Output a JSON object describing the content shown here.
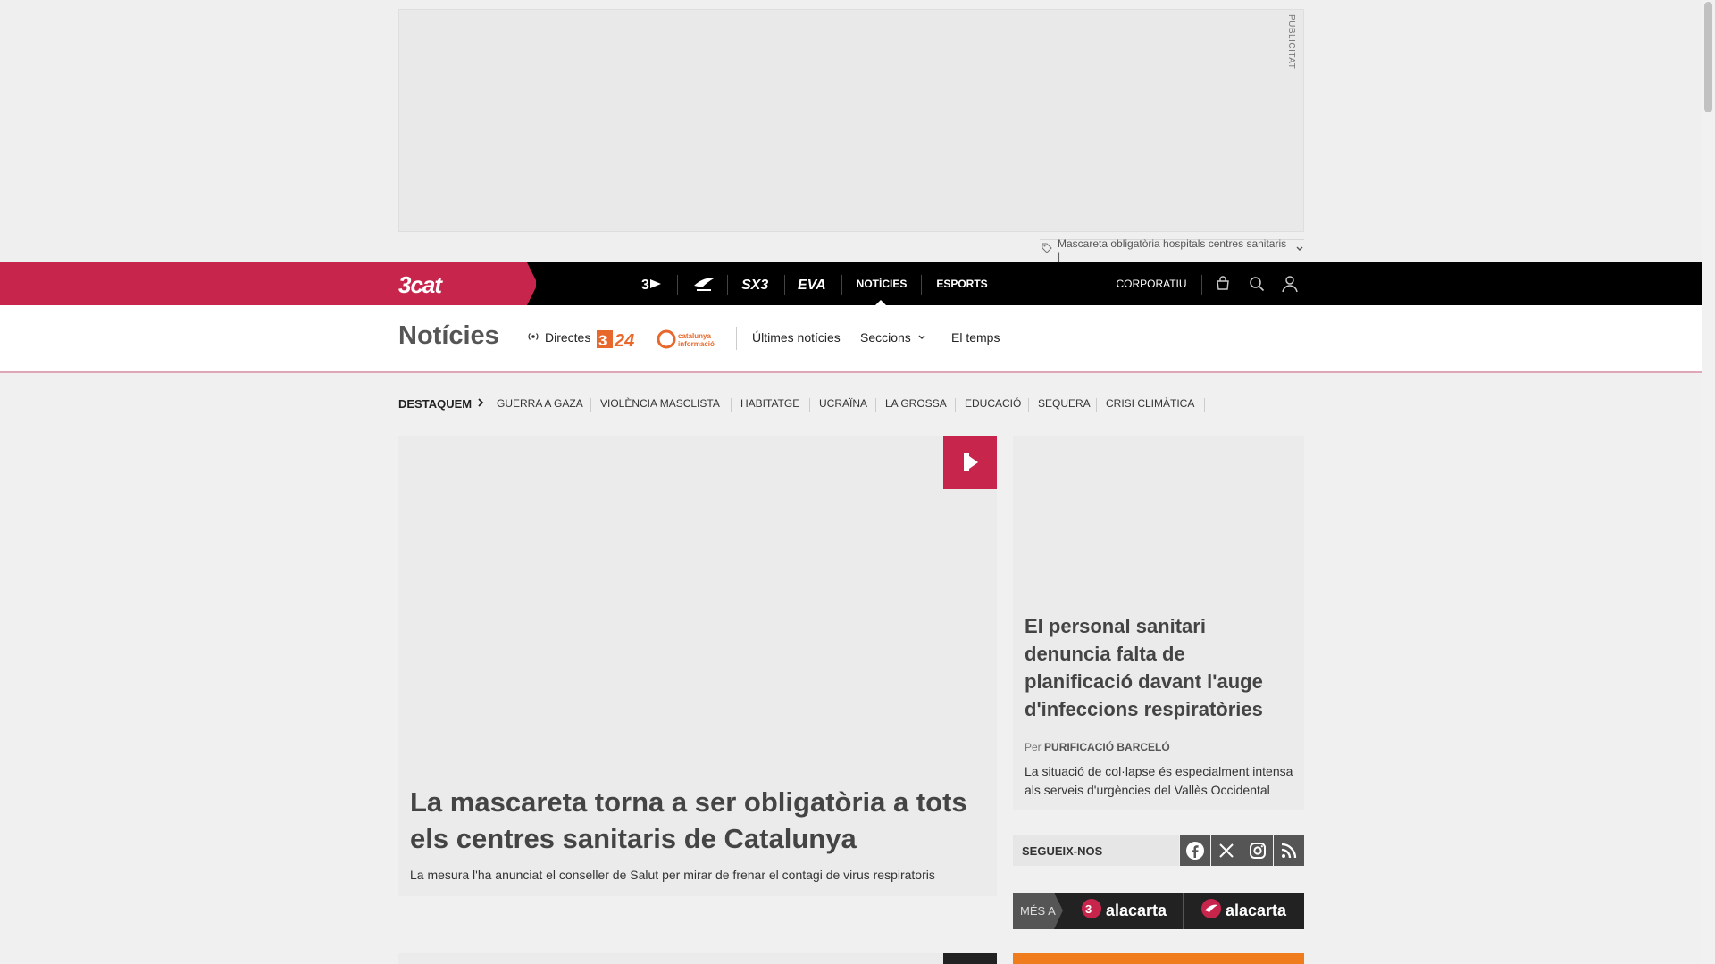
{
  "ad": {
    "label": "PUBLICITAT",
    "tag_text": "Mascareta obligatòria hospitals centres sanitaris |"
  },
  "topnav": {
    "brand": "3cat",
    "items": [
      "NOTÍCIES",
      "ESPORTS"
    ],
    "corporate": "CORPORATIU",
    "logos": [
      "tv3-logo",
      "catradio-logo",
      "sx3-logo",
      "eva-logo"
    ]
  },
  "section": {
    "title": "Notícies",
    "directes": "Directes",
    "logo_324": "3/24",
    "logo_ci": "catalunya informació",
    "ultimes": "Últimes notícies",
    "seccions": "Seccions",
    "temps": "El temps"
  },
  "highlights": {
    "label": "DESTAQUEM",
    "items": [
      "GUERRA A GAZA",
      "VIOLÈNCIA MASCLISTA",
      "HABITATGE",
      "UCRAÏNA",
      "LA GROSSA",
      "EDUCACIÓ",
      "SEQUERA",
      "CRISI CLIMÀTICA"
    ]
  },
  "main_article": {
    "headline": "La mascareta torna a ser obligatòria a tots els centres sanitaris de Catalunya",
    "summary": "La mesura l'ha anunciat el conseller de Salut per mirar de frenar el contagi de virus respiratoris"
  },
  "side_article": {
    "headline": "El personal sanitari denuncia falta de planificació davant l'auge d'infeccions respiratòries",
    "by_prefix": "Per",
    "author": "PURIFICACIÓ BARCELÓ",
    "summary": "La situació de col·lapse és especialment intensa als serveis d'urgències del Vallès Occidental"
  },
  "follow": {
    "label": "SEGUEIX-NOS",
    "icons": [
      "facebook-icon",
      "x-icon",
      "instagram-icon",
      "rss-icon"
    ]
  },
  "alacarta": {
    "prefix": "MÉS A",
    "label1": "alacarta",
    "label2": "alacarta"
  },
  "colors": {
    "brand": "#c8254d",
    "dark": "#000000",
    "accent_orange": "#f07d1d"
  }
}
